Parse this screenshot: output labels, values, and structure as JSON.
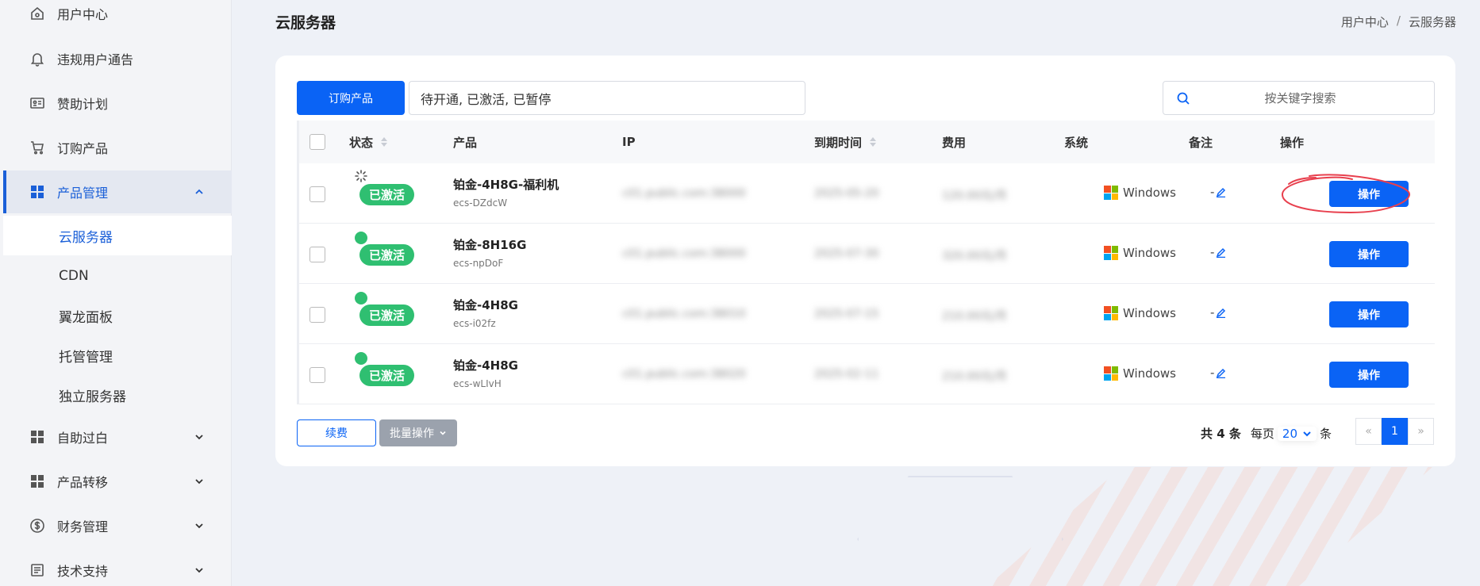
{
  "sidebar": {
    "items": [
      {
        "label": "用户中心",
        "icon": "home-icon"
      },
      {
        "label": "违规用户通告",
        "icon": "bell-icon"
      },
      {
        "label": "赞助计划",
        "icon": "id-card-icon"
      },
      {
        "label": "订购产品",
        "icon": "cart-icon"
      },
      {
        "label": "产品管理",
        "icon": "grid-icon",
        "expanded": true
      },
      {
        "label": "自助过白",
        "icon": "grid-icon"
      },
      {
        "label": "产品转移",
        "icon": "grid-icon"
      },
      {
        "label": "财务管理",
        "icon": "dollar-icon"
      },
      {
        "label": "技术支持",
        "icon": "document-icon"
      }
    ],
    "sub_items": [
      "云服务器",
      "CDN",
      "翼龙面板",
      "托管管理",
      "独立服务器"
    ]
  },
  "header": {
    "title": "云服务器",
    "breadcrumb": [
      "用户中心",
      "云服务器"
    ],
    "breadcrumb_sep": "/"
  },
  "toolbar": {
    "order_label": "订购产品",
    "status_filter": "待开通, 已激活, 已暂停",
    "search_placeholder": "按关键字搜索"
  },
  "table": {
    "columns": [
      "状态",
      "产品",
      "IP",
      "到期时间",
      "费用",
      "系统",
      "备注",
      "操作"
    ],
    "rows": [
      {
        "status": "已激活",
        "indicator": "spinner",
        "product": "铂金-4H8G-福利机",
        "id": "ecs-DZdcW",
        "ip": "c01.public.com:38000",
        "expire": "2025-05-20",
        "fee": "120.00元/月",
        "os": "Windows",
        "note": "-",
        "action": "操作"
      },
      {
        "status": "已激活",
        "indicator": "dot",
        "product": "铂金-8H16G",
        "id": "ecs-npDoF",
        "ip": "c01.public.com:38000",
        "expire": "2025-07-30",
        "fee": "320.00元/月",
        "os": "Windows",
        "note": "-",
        "action": "操作"
      },
      {
        "status": "已激活",
        "indicator": "dot",
        "product": "铂金-4H8G",
        "id": "ecs-i02fz",
        "ip": "c01.public.com:38010",
        "expire": "2025-07-15",
        "fee": "210.00元/月",
        "os": "Windows",
        "note": "-",
        "action": "操作"
      },
      {
        "status": "已激活",
        "indicator": "dot",
        "product": "铂金-4H8G",
        "id": "ecs-wLIvH",
        "ip": "c01.public.com:38020",
        "expire": "2025-02-11",
        "fee": "210.00元/月",
        "os": "Windows",
        "note": "-",
        "action": "操作"
      }
    ]
  },
  "footer": {
    "renew_label": "续费",
    "batch_label": "批量操作",
    "total": "共 4 条",
    "per_page_prefix": "每页",
    "per_page_value": "20",
    "per_page_suffix": "条",
    "prev": "«",
    "current_page": "1",
    "next": "»"
  },
  "colors": {
    "primary": "#0a63f5",
    "active_badge": "#2fbf71",
    "annotation": "#e8404e"
  }
}
